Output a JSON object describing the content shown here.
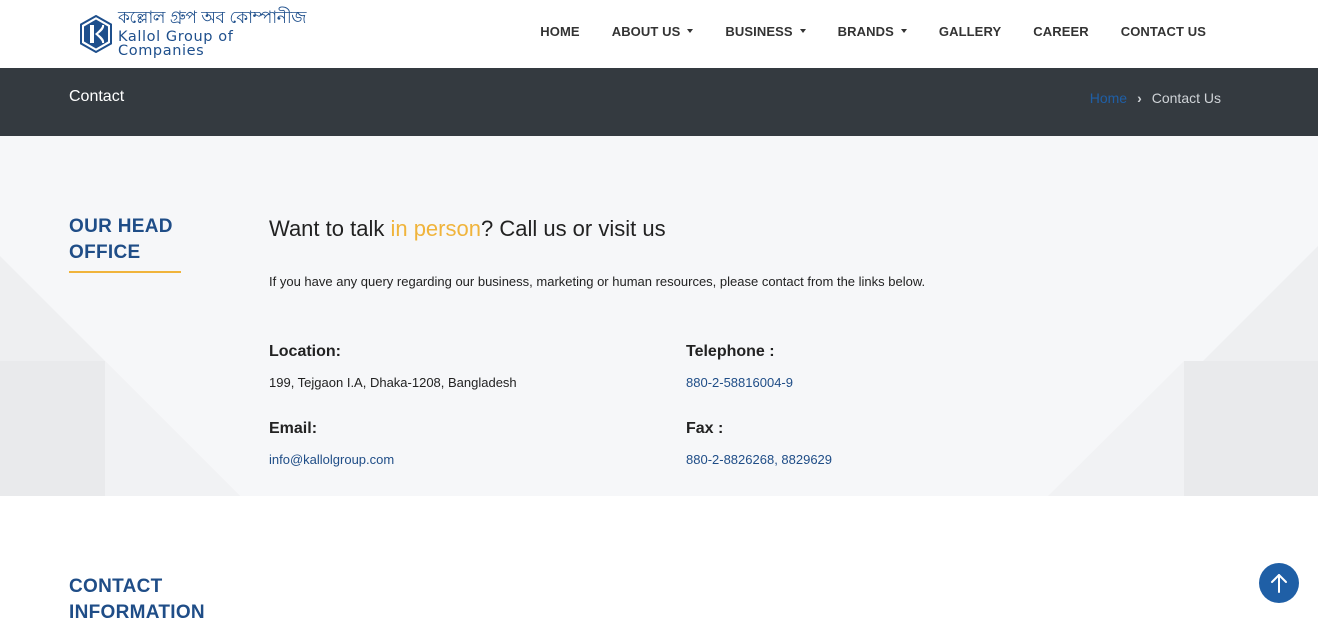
{
  "header": {
    "logo": {
      "bangla": "কল্লোল গ্রুপ অব কোম্পানীজ",
      "english": "Kallol Group of Companies"
    },
    "nav": [
      {
        "label": "HOME",
        "dropdown": false
      },
      {
        "label": "ABOUT US",
        "dropdown": true
      },
      {
        "label": "BUSINESS",
        "dropdown": true
      },
      {
        "label": "BRANDS",
        "dropdown": true
      },
      {
        "label": "GALLERY",
        "dropdown": false
      },
      {
        "label": "CAREER",
        "dropdown": false
      },
      {
        "label": "CONTACT US",
        "dropdown": false
      }
    ]
  },
  "titlebar": {
    "title": "Contact",
    "breadcrumb": {
      "home": "Home",
      "current": "Contact Us"
    }
  },
  "office": {
    "heading_line1": "OUR HEAD",
    "heading_line2": "OFFICE",
    "tagline_start": "Want to talk ",
    "tagline_accent": "in person",
    "tagline_end": "? Call us or visit us",
    "intro": "If you have any query regarding our business, marketing or human resources, please contact from the links below.",
    "location_label": "Location:",
    "location_value": "199, Tejgaon I.A, Dhaka-1208, Bangladesh",
    "telephone_label": "Telephone :",
    "telephone_value": "880-2-58816004-9",
    "email_label": "Email:",
    "email_value": "info@kallolgroup.com",
    "fax_label": "Fax :",
    "fax_value": "880-2-8826268, 8829629"
  },
  "contact_info": {
    "heading_line1": "CONTACT",
    "heading_line2": "INFORMATION"
  },
  "scroll_top": {
    "icon": "arrow-up-icon"
  },
  "colors": {
    "brand_blue": "#1f4d87",
    "accent_gold": "#f0b43c",
    "titlebar_bg": "#343a40",
    "link_blue": "#1f5fa6"
  }
}
